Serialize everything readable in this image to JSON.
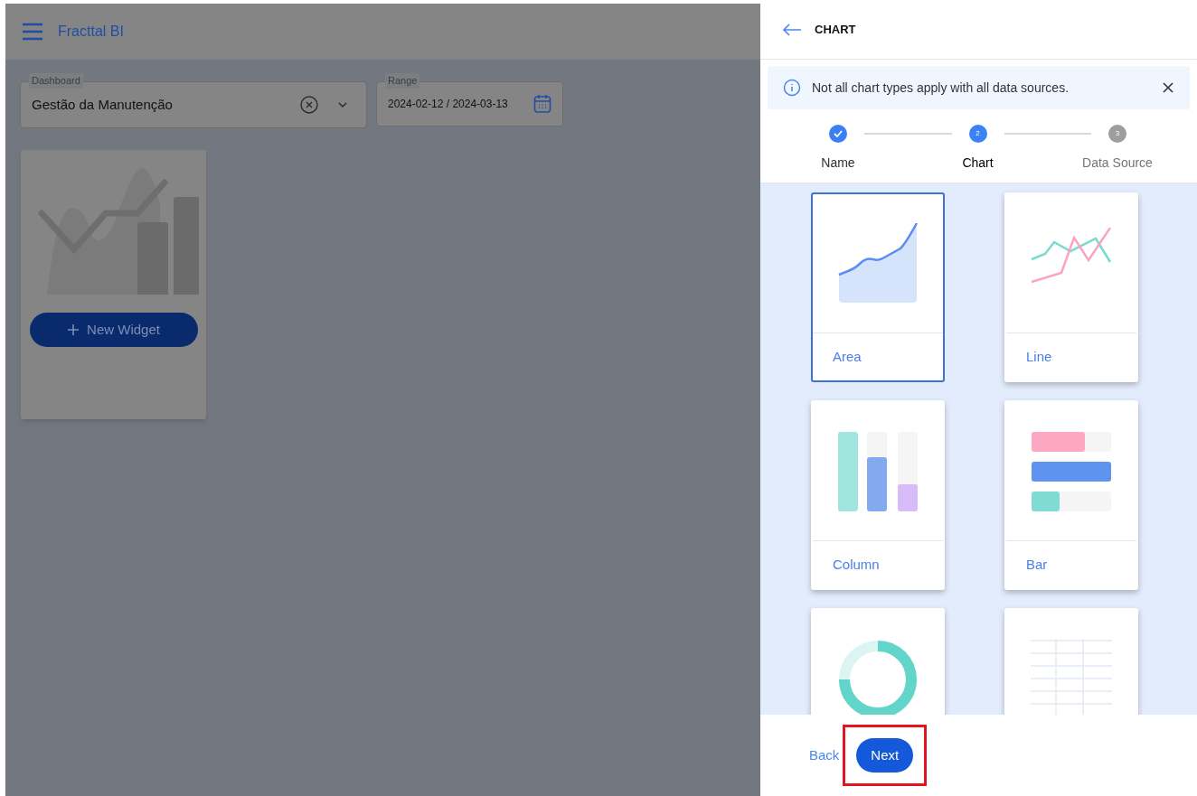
{
  "app_bar": {
    "title": "Fracttal BI"
  },
  "filters": {
    "dashboard": {
      "label": "Dashboard",
      "value": "Gestão da Manutenção"
    },
    "range": {
      "label": "Range",
      "value": "2024-02-12 / 2024-03-13"
    }
  },
  "widget_card": {
    "button": "New Widget"
  },
  "panel": {
    "title": "CHART",
    "alert": {
      "text": "Not all chart types apply with all data sources."
    },
    "steps": [
      {
        "label": "Name",
        "completed": true,
        "selected": false
      },
      {
        "label": "Chart",
        "number": "2",
        "completed": false,
        "selected": true
      },
      {
        "label": "Data Source",
        "number": "3",
        "completed": false,
        "selected": false
      }
    ],
    "chart_types": [
      {
        "kind": "area",
        "label": "Area",
        "selected": true
      },
      {
        "kind": "line",
        "label": "Line",
        "selected": false
      },
      {
        "kind": "column",
        "label": "Column",
        "selected": false
      },
      {
        "kind": "bar",
        "label": "Bar",
        "selected": false
      },
      {
        "kind": "donut",
        "selected": false
      },
      {
        "kind": "table",
        "selected": false
      }
    ],
    "footer": {
      "back": "Back",
      "next": {
        "label": "Next",
        "highlighted": true
      }
    }
  }
}
